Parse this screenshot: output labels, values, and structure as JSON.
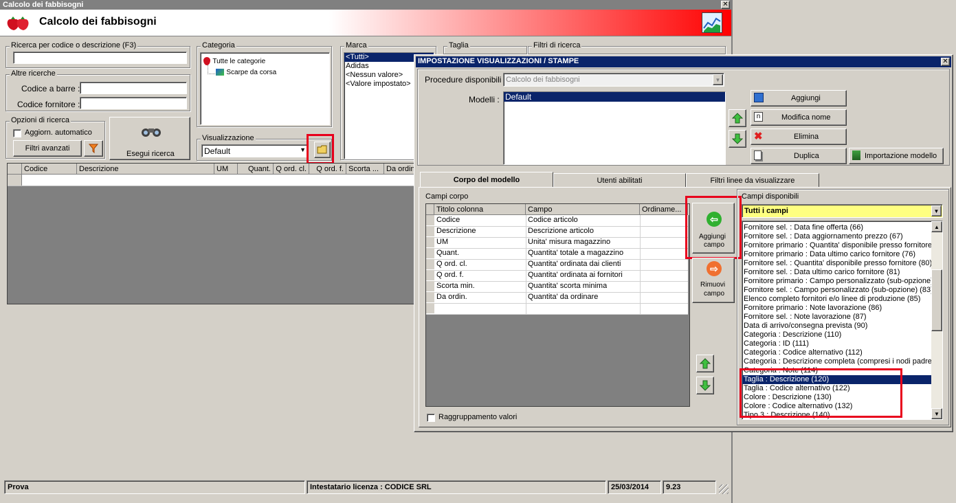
{
  "window": {
    "title": "Calcolo dei fabbisogni",
    "header_title": "Calcolo dei fabbisogni"
  },
  "search": {
    "code_group": "Ricerca per codice o descrizione (F3)",
    "other_group": "Altre ricerche",
    "barcode_label": "Codice a barre :",
    "supplier_code_label": "Codice fornitore :",
    "options_group": "Opzioni di ricerca",
    "auto_update_label": "Aggiorn. automatico",
    "advanced_filters": "Filtri avanzati",
    "execute": "Esegui ricerca"
  },
  "category": {
    "group": "Categoria",
    "items": [
      "Tutte le categorie",
      "Scarpe da corsa"
    ]
  },
  "visualization": {
    "group": "Visualizzazione",
    "value": "Default"
  },
  "brand": {
    "group": "Marca",
    "items": [
      "<Tutti>",
      "Adidas",
      "<Nessun valore>",
      "<Valore impostato>"
    ]
  },
  "size": {
    "group": "Taglia"
  },
  "filters": {
    "group": "Filtri di ricerca"
  },
  "results_columns": [
    "Codice",
    "Descrizione",
    "UM",
    "Quant.",
    "Q ord. cl.",
    "Q ord. f.",
    "Scorta ...",
    "Da ordin"
  ],
  "status_bar": {
    "left": "Prova",
    "license": "Intestatario licenza : CODICE SRL",
    "date": "25/03/2014",
    "version": "9.23"
  },
  "dialog": {
    "title": "IMPOSTAZIONE VISUALIZZAZIONI / STAMPE",
    "procedures_label": "Procedure disponibili :",
    "procedures_value": "Calcolo dei fabbisogni",
    "models_label": "Modelli :",
    "models": [
      "Default"
    ],
    "buttons": {
      "add": "Aggiungi",
      "rename": "Modifica nome",
      "delete": "Elimina",
      "duplicate": "Duplica",
      "import": "Importazione modello"
    },
    "tabs": [
      "Corpo del modello",
      "Utenti abilitati",
      "Filtri linee da visualizzare"
    ],
    "body_fields_label": "Campi corpo",
    "grid_columns": [
      "Titolo colonna",
      "Campo",
      "Ordiname..."
    ],
    "grid_rows": [
      {
        "title": "Codice",
        "field": "Codice articolo"
      },
      {
        "title": "Descrizione",
        "field": "Descrizione articolo"
      },
      {
        "title": "UM",
        "field": "Unita' misura magazzino"
      },
      {
        "title": "Quant.",
        "field": "Quantita' totale a magazzino"
      },
      {
        "title": "Q ord. cl.",
        "field": "Quantita' ordinata dai clienti"
      },
      {
        "title": "Q ord. f.",
        "field": "Quantita' ordinata ai fornitori"
      },
      {
        "title": "Scorta min.",
        "field": "Quantita' scorta minima"
      },
      {
        "title": "Da ordin.",
        "field": "Quantita' da ordinare"
      }
    ],
    "add_field_line1": "Aggiungi",
    "add_field_line2": "campo",
    "remove_field_line1": "Rimuovi",
    "remove_field_line2": "campo",
    "group_values_label": "Raggruppamento valori",
    "available_fields_label": "Campi disponibili",
    "available_filter": "Tutti i campi",
    "available_fields": [
      "Fornitore sel. : Data fine offerta (66)",
      "Fornitore sel. : Data aggiornamento prezzo (67)",
      "Fornitore primario : Quantita' disponibile presso fornitore",
      "Fornitore primario : Data ultimo carico fornitore (76)",
      "Fornitore sel. : Quantita' disponibile presso fornitore (80)",
      "Fornitore sel. : Data ultimo carico fornitore (81)",
      "Fornitore primario : Campo personalizzato (sub-opzione) (",
      "Fornitore sel. : Campo personalizzato (sub-opzione) (83)",
      "Elenco completo fornitori e/o linee di produzione (85)",
      "Fornitore primario : Note lavorazione (86)",
      "Fornitore sel. : Note lavorazione (87)",
      "Data di arrivo/consegna prevista (90)",
      "Categoria : Descrizione (110)",
      "Categoria : ID (111)",
      "Categoria : Codice alternativo (112)",
      "Categoria : Descrizione completa (compresi i nodi padre) (",
      "Categoria : Note (114)",
      "Taglia : Descrizione (120)",
      "Taglia : Codice alternativo (122)",
      "Colore : Descrizione (130)",
      "Colore : Codice alternativo (132)",
      "Tipo 3 : Descrizione (140)"
    ],
    "selected_index": 17
  },
  "colors": {
    "selection": "#0a246a",
    "highlight": "#e8001c",
    "filter_bg": "#ffff80"
  }
}
